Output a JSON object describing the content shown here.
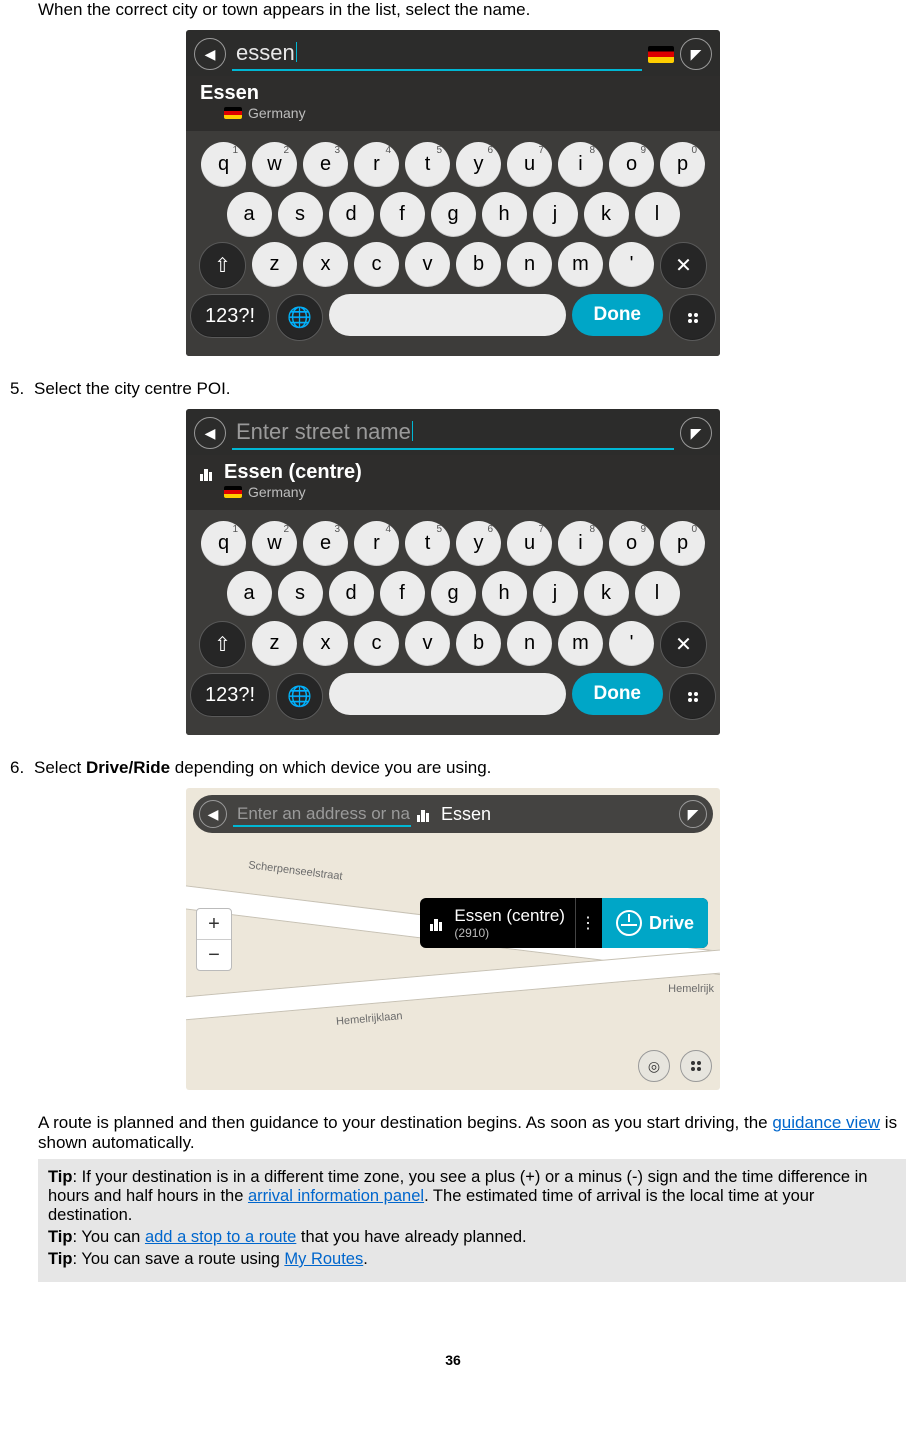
{
  "intro": "When the correct city or town appears in the list, select the name.",
  "step5": {
    "num": "5.",
    "text": "Select the city centre POI."
  },
  "step6": {
    "num": "6.",
    "prefix": "Select ",
    "bold": "Drive/Ride",
    "suffix": " depending on which device you are using."
  },
  "paraAfter": {
    "p1": "A route is planned and then guidance to your destination begins. As soon as you start driving, the ",
    "link1": "guidance view",
    "p2": " is shown automatically."
  },
  "tips": {
    "t1a": "Tip",
    "t1b": ": If your destination is in a different time zone, you see a plus (+) or a minus (-) sign and the time difference in hours and half hours in the ",
    "t1link": "arrival information panel",
    "t1c": ". The estimated time of arrival is the local time at your destination.",
    "t2a": "Tip",
    "t2b": ": You can ",
    "t2link": "add a stop to a route",
    "t2c": " that you have already planned.",
    "t3a": "Tip",
    "t3b": ": You can save a route using ",
    "t3link": "My Routes",
    "t3c": "."
  },
  "dev1": {
    "query": "essen",
    "suggTitle": "Essen",
    "suggSub": "Germany"
  },
  "dev2": {
    "placeholder": "Enter street name",
    "suggTitle": "Essen (centre)",
    "suggSub": "Germany"
  },
  "dev3": {
    "placeholder": "Enter an address or nam",
    "rightLabel": "Essen",
    "resultTitle": "Essen (centre)",
    "resultSub": "(2910)",
    "drive": "Drive",
    "road1": "Scherpenseelstraat",
    "road2": "Hemelrijklaan",
    "road3": "Hemelrijk"
  },
  "keyboard": {
    "row1": [
      {
        "k": "q",
        "n": "1"
      },
      {
        "k": "w",
        "n": "2"
      },
      {
        "k": "e",
        "n": "3"
      },
      {
        "k": "r",
        "n": "4"
      },
      {
        "k": "t",
        "n": "5"
      },
      {
        "k": "y",
        "n": "6"
      },
      {
        "k": "u",
        "n": "7"
      },
      {
        "k": "i",
        "n": "8"
      },
      {
        "k": "o",
        "n": "9"
      },
      {
        "k": "p",
        "n": "0"
      }
    ],
    "row2": [
      "a",
      "s",
      "d",
      "f",
      "g",
      "h",
      "j",
      "k",
      "l"
    ],
    "row3": [
      "z",
      "x",
      "c",
      "v",
      "b",
      "n",
      "m",
      "'"
    ],
    "mode": "123?!",
    "done": "Done"
  },
  "pageNumber": "36"
}
